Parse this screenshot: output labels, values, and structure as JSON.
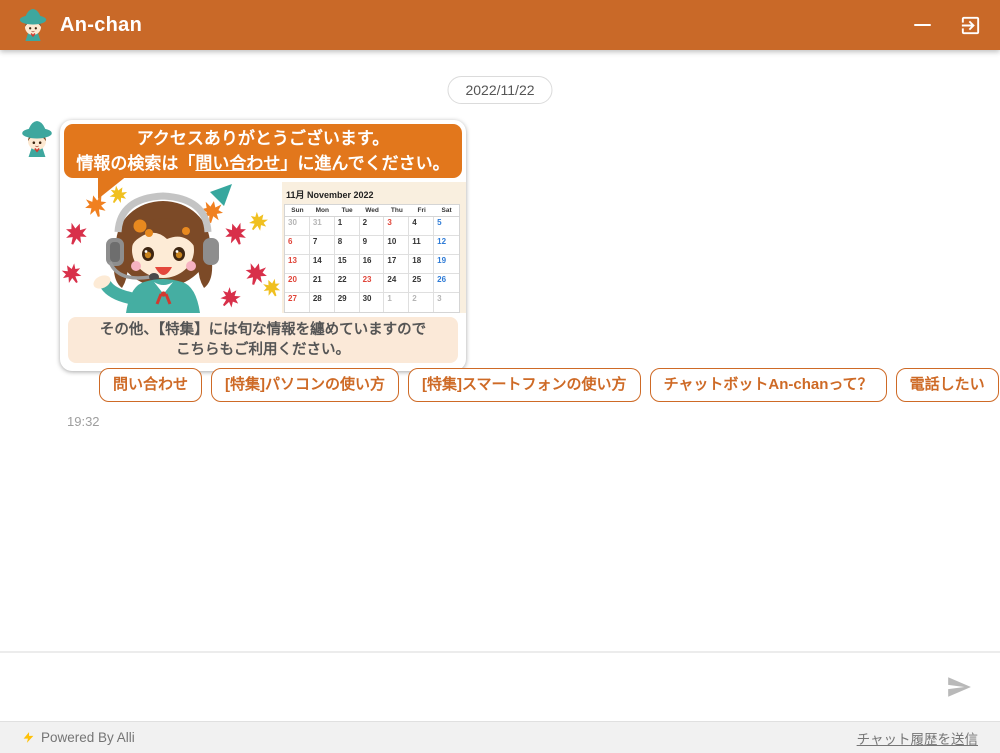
{
  "colors": {
    "header-bg": "#C96928",
    "banner-bg": "#E2771C",
    "accent": "#CE6A26",
    "note-bg": "#FBE9D8",
    "cal-red": "#E04438",
    "cal-blue": "#2E7BD6",
    "bolt": "#FFC107"
  },
  "icons": {
    "header_avatar": "mascot-avatar-icon",
    "minimize": "minimize-icon",
    "exit": "exit-icon",
    "send": "send-icon",
    "powered_bolt": "lightning-icon"
  },
  "header": {
    "title": "An-chan"
  },
  "chat": {
    "date_chip": "2022/11/22",
    "timestamp": "19:32"
  },
  "card": {
    "banner_line1": "アクセスありがとうございます。",
    "banner_line2_pre": "情報の検索は「",
    "banner_line2_link": "問い合わせ",
    "banner_line2_post": "」に進んでください。",
    "note_line1": "その他、【特集】には旬な情報を纏めていますので",
    "note_line2": "こちらもご利用ください。"
  },
  "calendar": {
    "title": "11月 November 2022",
    "weekdays": [
      "Sun",
      "Mon",
      "Tue",
      "Wed",
      "Thu",
      "Fri",
      "Sat"
    ],
    "weeks": [
      [
        {
          "d": "30",
          "t": "out"
        },
        {
          "d": "31",
          "t": "out"
        },
        {
          "d": "1",
          "t": ""
        },
        {
          "d": "2",
          "t": ""
        },
        {
          "d": "3",
          "t": "red"
        },
        {
          "d": "4",
          "t": ""
        },
        {
          "d": "5",
          "t": "blue"
        }
      ],
      [
        {
          "d": "6",
          "t": "red"
        },
        {
          "d": "7",
          "t": ""
        },
        {
          "d": "8",
          "t": ""
        },
        {
          "d": "9",
          "t": ""
        },
        {
          "d": "10",
          "t": ""
        },
        {
          "d": "11",
          "t": ""
        },
        {
          "d": "12",
          "t": "blue"
        }
      ],
      [
        {
          "d": "13",
          "t": "red"
        },
        {
          "d": "14",
          "t": ""
        },
        {
          "d": "15",
          "t": ""
        },
        {
          "d": "16",
          "t": ""
        },
        {
          "d": "17",
          "t": ""
        },
        {
          "d": "18",
          "t": ""
        },
        {
          "d": "19",
          "t": "blue"
        }
      ],
      [
        {
          "d": "20",
          "t": "red"
        },
        {
          "d": "21",
          "t": ""
        },
        {
          "d": "22",
          "t": ""
        },
        {
          "d": "23",
          "t": "red"
        },
        {
          "d": "24",
          "t": ""
        },
        {
          "d": "25",
          "t": ""
        },
        {
          "d": "26",
          "t": "blue"
        }
      ],
      [
        {
          "d": "27",
          "t": "red"
        },
        {
          "d": "28",
          "t": ""
        },
        {
          "d": "29",
          "t": ""
        },
        {
          "d": "30",
          "t": ""
        },
        {
          "d": "1",
          "t": "out"
        },
        {
          "d": "2",
          "t": "out"
        },
        {
          "d": "3",
          "t": "out"
        }
      ]
    ]
  },
  "quick_replies": [
    "問い合わせ",
    "[特集]パソコンの使い方",
    "[特集]スマートフォンの使い方",
    "チャットボットAn-chanって？",
    "電話したい"
  ],
  "footer": {
    "powered_by": "Powered By Alli",
    "history_link": "チャット履歴を送信"
  }
}
